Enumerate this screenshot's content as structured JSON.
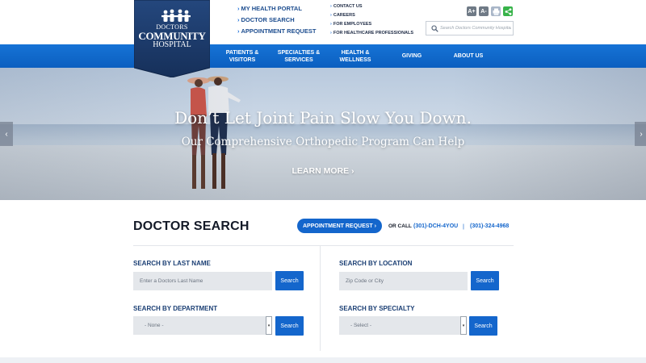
{
  "logo": {
    "line1": "DOCTORS",
    "line2": "COMMUNITY",
    "line3": "HOSPITAL"
  },
  "quick_links": [
    "MY HEALTH PORTAL",
    "DOCTOR SEARCH",
    "APPOINTMENT REQUEST"
  ],
  "utility_links": [
    "CONTACT US",
    "CAREERS",
    "FOR EMPLOYEES",
    "FOR HEALTHCARE PROFESSIONALS"
  ],
  "tools": {
    "increase_text": "A+",
    "decrease_text": "A-"
  },
  "site_search": {
    "placeholder": "Search Doctors Community Hospital"
  },
  "nav": [
    {
      "line1": "PATIENTS &",
      "line2": "VISITORS"
    },
    {
      "line1": "SPECIALTIES &",
      "line2": "SERVICES"
    },
    {
      "line1": "HEALTH &",
      "line2": "WELLNESS"
    },
    {
      "line1": "GIVING",
      "line2": ""
    },
    {
      "line1": "ABOUT US",
      "line2": ""
    }
  ],
  "hero": {
    "title": "Don’t Let Joint Pain Slow You Down.",
    "subtitle": "Our Comprehensive Orthopedic Program Can Help",
    "cta": "LEARN MORE ›",
    "prev": "‹",
    "next": "›"
  },
  "doctor_search": {
    "title": "DOCTOR SEARCH",
    "appointment_button": "APPOINTMENT REQUEST ›",
    "or_call": "OR CALL",
    "phone1": "(301)-DCH-4YOU",
    "separator": "|",
    "phone2": "(301)-324-4968",
    "last_name": {
      "label": "SEARCH BY LAST NAME",
      "placeholder": "Enter a Doctors Last Name",
      "button": "Search"
    },
    "location": {
      "label": "SEARCH BY LOCATION",
      "placeholder": "Zip Code or City",
      "button": "Search"
    },
    "department": {
      "label": "SEARCH BY DEPARTMENT",
      "selected": "- None -",
      "button": "Search"
    },
    "specialty": {
      "label": "SEARCH BY SPECIALTY",
      "selected": "- Select -",
      "button": "Search"
    }
  },
  "colors": {
    "brand_navy": "#1b3a6e",
    "nav_blue": "#0b5fc0",
    "button_blue": "#1466cc",
    "share_green": "#38b34a"
  }
}
